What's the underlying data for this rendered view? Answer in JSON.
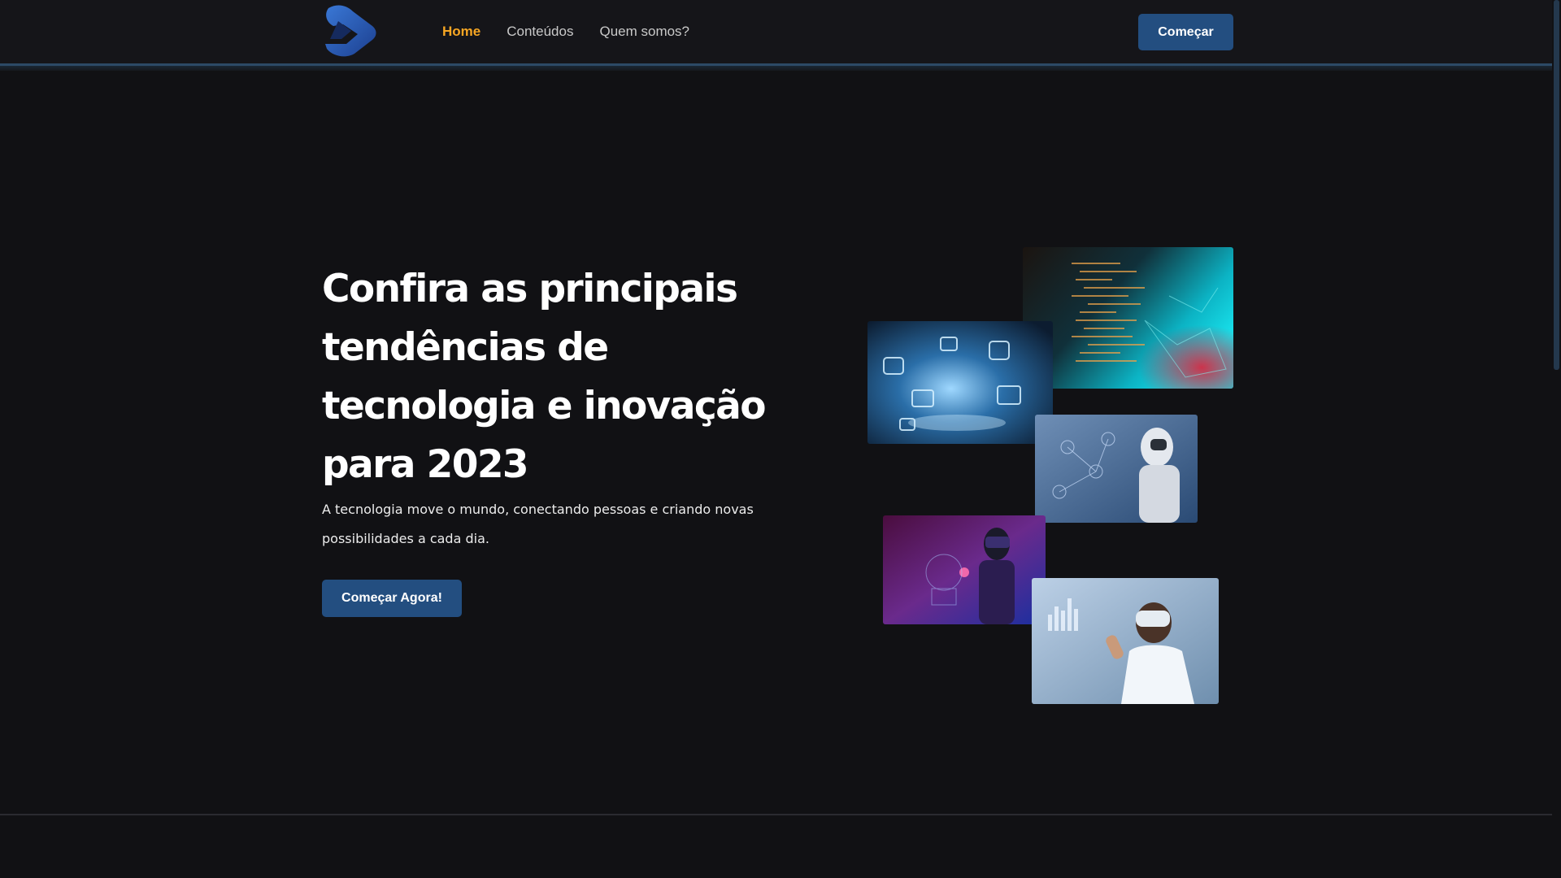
{
  "header": {
    "logo_icon": "brand-logo",
    "nav": [
      {
        "label": "Home",
        "active": true
      },
      {
        "label": "Conteúdos",
        "active": false
      },
      {
        "label": "Quem somos?",
        "active": false
      }
    ],
    "start_button": "Começar"
  },
  "hero": {
    "title_lines": [
      "Confira as principais",
      "tendências de",
      "tecnologia e inovação",
      "para 2023"
    ],
    "subtitle_lines": [
      "A tecnologia move o mundo, conectando pessoas e criando novas",
      "possibilidades a cada dia."
    ],
    "cta_button": "Começar Agora!"
  },
  "images": [
    {
      "name": "code-screen-image"
    },
    {
      "name": "digital-icons-image"
    },
    {
      "name": "ai-robot-image"
    },
    {
      "name": "vr-headset-image"
    },
    {
      "name": "vr-scientist-image"
    }
  ],
  "colors": {
    "background": "#111114",
    "header": "#151519",
    "accent": "#f6a623",
    "button": "#234e80"
  }
}
